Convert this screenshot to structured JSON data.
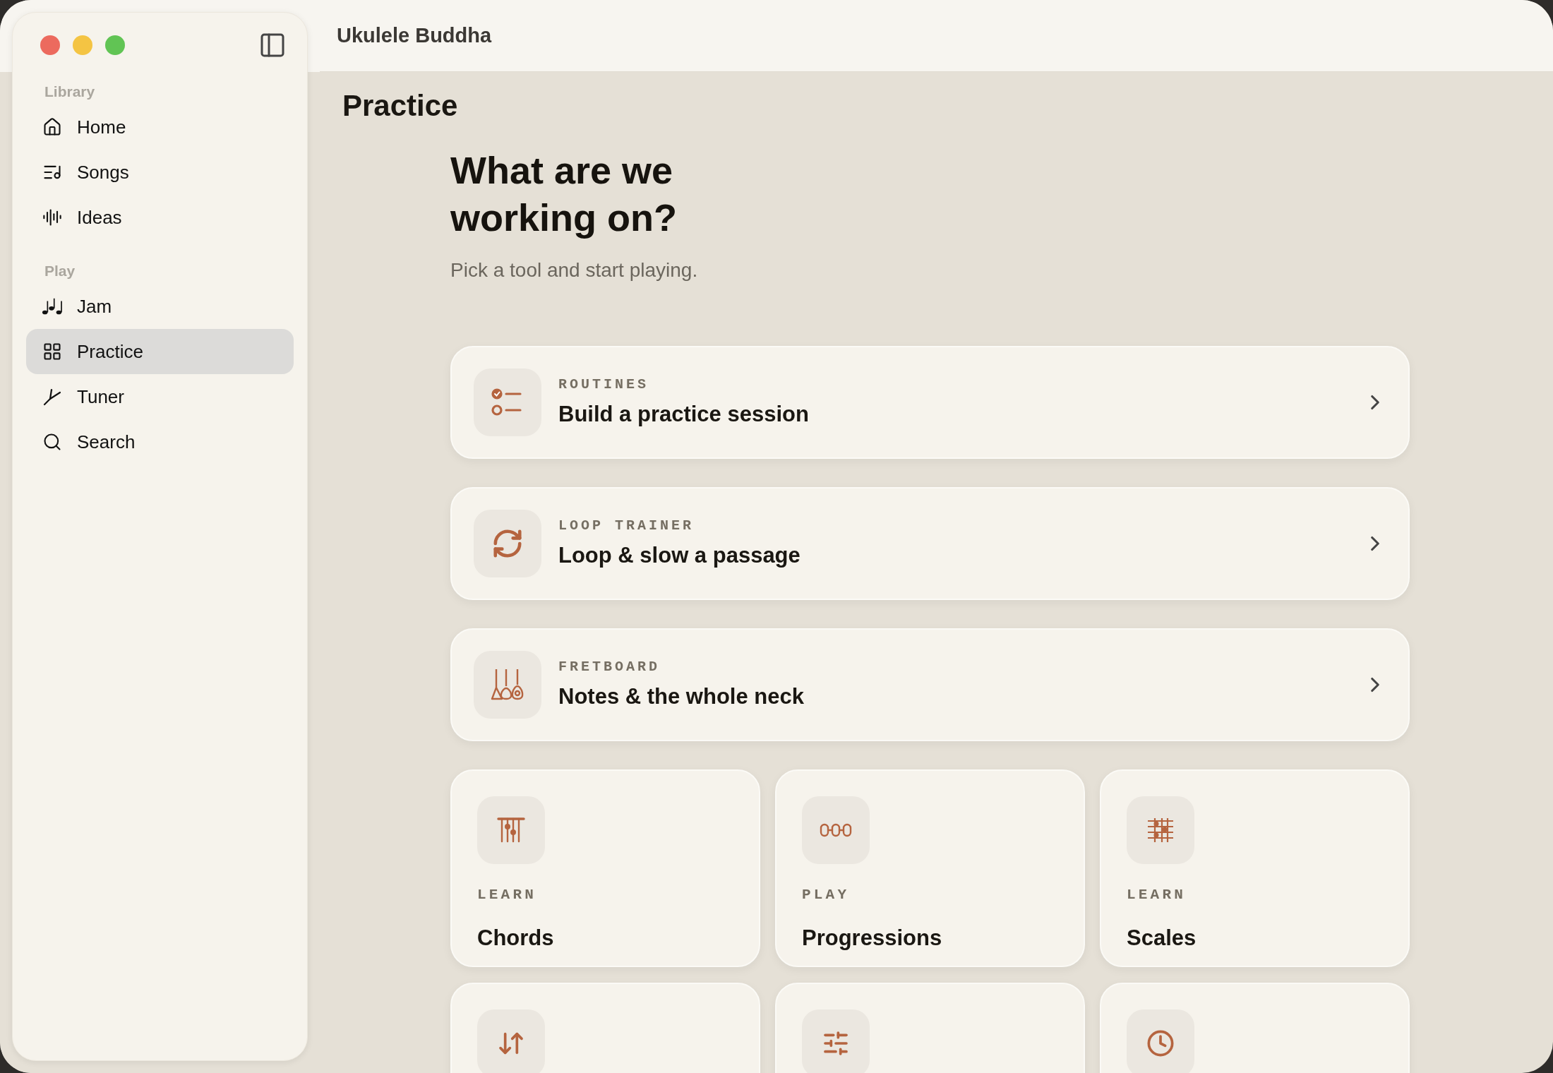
{
  "window": {
    "title": "Ukulele Buddha"
  },
  "sidebar": {
    "sections": [
      {
        "label": "Library",
        "items": [
          {
            "label": "Home",
            "selected": false
          },
          {
            "label": "Songs",
            "selected": false
          },
          {
            "label": "Ideas",
            "selected": false
          }
        ]
      },
      {
        "label": "Play",
        "items": [
          {
            "label": "Jam",
            "selected": false
          },
          {
            "label": "Practice",
            "selected": true
          },
          {
            "label": "Tuner",
            "selected": false
          },
          {
            "label": "Search",
            "selected": false
          }
        ]
      }
    ]
  },
  "page": {
    "title": "Practice",
    "heading": "What are we working on?",
    "subtitle": "Pick a tool and start playing."
  },
  "feature_cards": [
    {
      "eyebrow": "ROUTINES",
      "title": "Build a practice session"
    },
    {
      "eyebrow": "LOOP TRAINER",
      "title": "Loop & slow a passage"
    },
    {
      "eyebrow": "FRETBOARD",
      "title": "Notes & the whole neck"
    }
  ],
  "tiles": [
    {
      "eyebrow": "LEARN",
      "title": "Chords"
    },
    {
      "eyebrow": "PLAY",
      "title": "Progressions"
    },
    {
      "eyebrow": "LEARN",
      "title": "Scales"
    }
  ]
}
